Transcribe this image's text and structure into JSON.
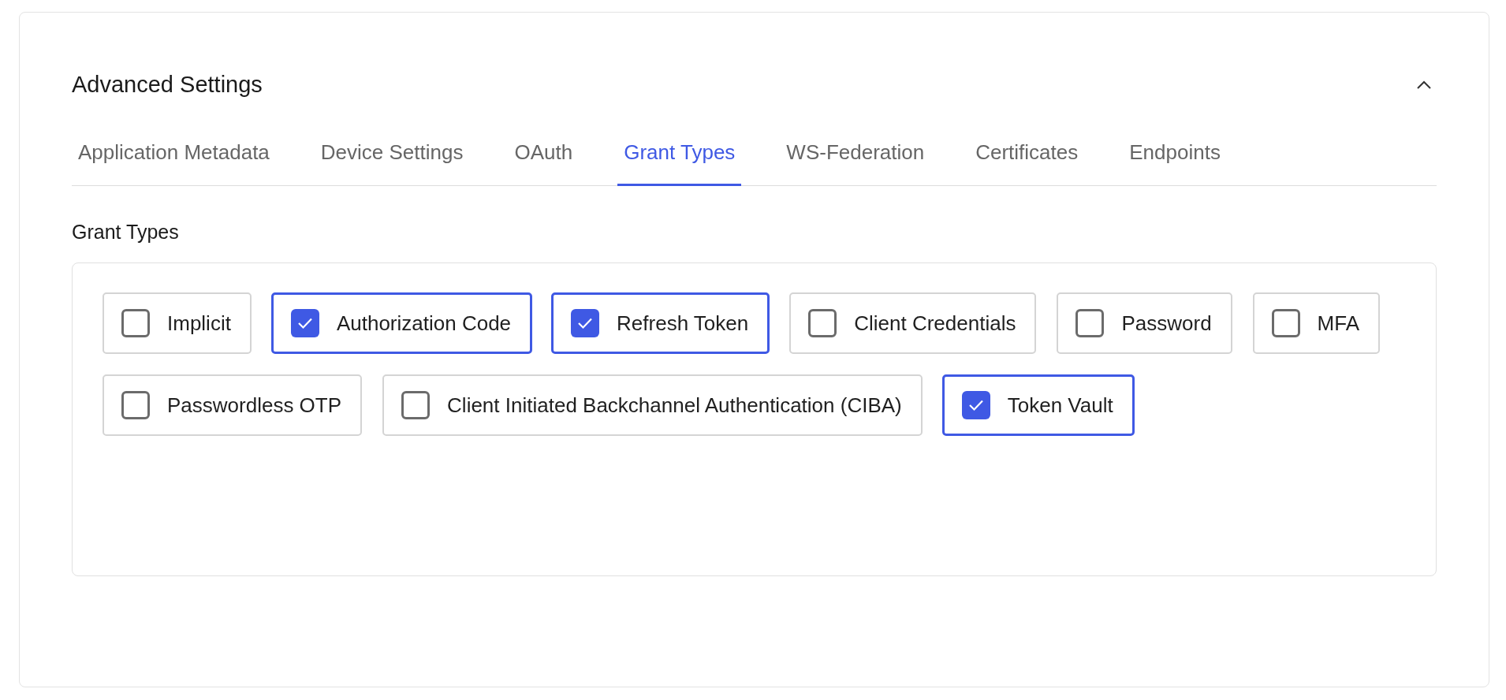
{
  "panel": {
    "title": "Advanced Settings",
    "expanded": true
  },
  "tabs": [
    {
      "label": "Application Metadata",
      "selected": false
    },
    {
      "label": "Device Settings",
      "selected": false
    },
    {
      "label": "OAuth",
      "selected": false
    },
    {
      "label": "Grant Types",
      "selected": true
    },
    {
      "label": "WS-Federation",
      "selected": false
    },
    {
      "label": "Certificates",
      "selected": false
    },
    {
      "label": "Endpoints",
      "selected": false
    }
  ],
  "section_title": "Grant Types",
  "grant_types": [
    {
      "label": "Implicit",
      "checked": false
    },
    {
      "label": "Authorization Code",
      "checked": true
    },
    {
      "label": "Refresh Token",
      "checked": true
    },
    {
      "label": "Client Credentials",
      "checked": false
    },
    {
      "label": "Password",
      "checked": false
    },
    {
      "label": "MFA",
      "checked": false
    },
    {
      "label": "Passwordless OTP",
      "checked": false
    },
    {
      "label": "Client Initiated Backchannel Authentication (CIBA)",
      "checked": false
    },
    {
      "label": "Token Vault",
      "checked": true
    }
  ]
}
